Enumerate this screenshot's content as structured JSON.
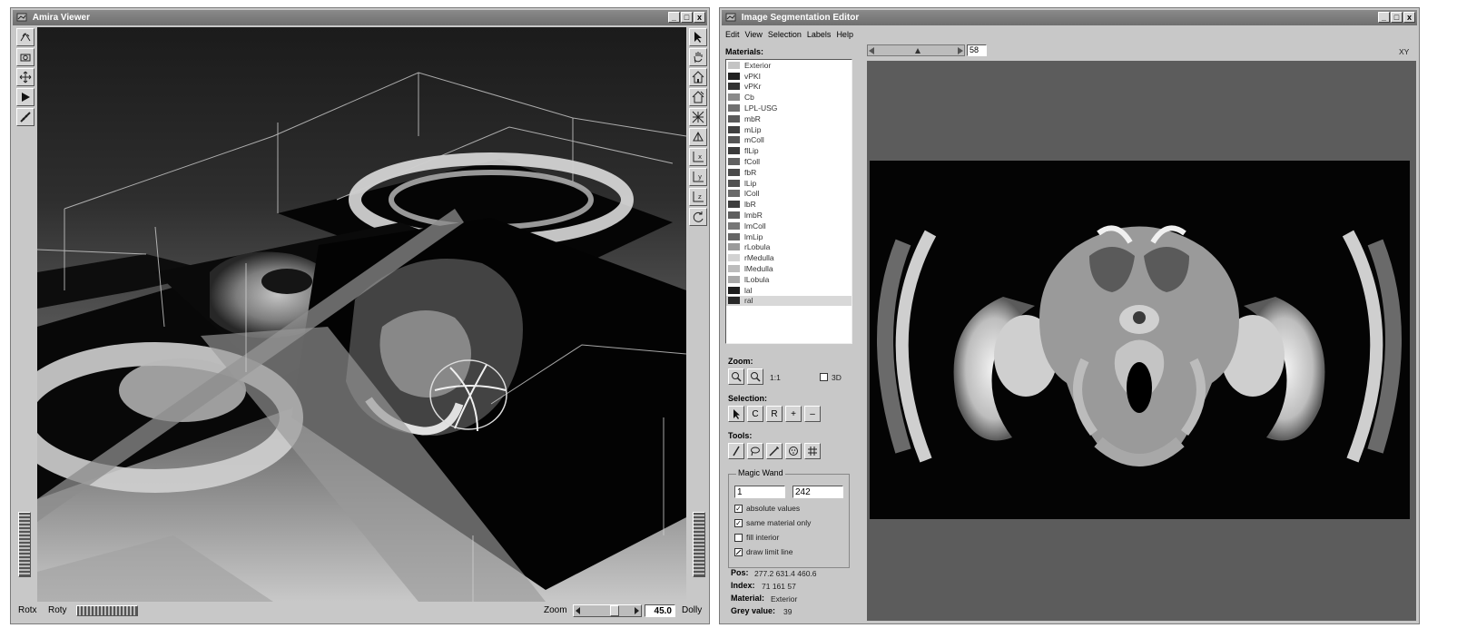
{
  "viewer": {
    "title": "Amira Viewer",
    "window_buttons": [
      "_",
      "□",
      "x"
    ],
    "left_toolbar": [
      {
        "icon": "interact-icon"
      },
      {
        "icon": "camera-icon"
      },
      {
        "icon": "move-icon"
      },
      {
        "icon": "play-icon"
      },
      {
        "icon": "measure-icon"
      }
    ],
    "right_toolbar": [
      {
        "icon": "pointer-icon"
      },
      {
        "icon": "hand-icon"
      },
      {
        "icon": "home-icon"
      },
      {
        "icon": "set-home-icon"
      },
      {
        "icon": "view-all-icon"
      },
      {
        "icon": "perspective-icon"
      },
      {
        "icon": "axis-x-icon"
      },
      {
        "icon": "axis-y-icon"
      },
      {
        "icon": "axis-z-icon"
      },
      {
        "icon": "rotate-icon"
      }
    ],
    "bottom": {
      "rotx": "Rotx",
      "roty": "Roty",
      "zoom": "Zoom",
      "zoom_value": "45.0",
      "dolly": "Dolly"
    }
  },
  "editor": {
    "title": "Image Segmentation Editor",
    "window_buttons": [
      "_",
      "□",
      "x"
    ],
    "menu": [
      "Edit",
      "View",
      "Selection",
      "Labels",
      "Help"
    ],
    "materials_label": "Materials:",
    "materials": [
      {
        "name": "Exterior",
        "color": "#c4c4c4"
      },
      {
        "name": "vPKI",
        "color": "#222222"
      },
      {
        "name": "vPKr",
        "color": "#333333"
      },
      {
        "name": "Cb",
        "color": "#8a8a8a"
      },
      {
        "name": "LPL-USG",
        "color": "#707070"
      },
      {
        "name": "mbR",
        "color": "#5a5a5a"
      },
      {
        "name": "mLip",
        "color": "#404040"
      },
      {
        "name": "mColl",
        "color": "#555555"
      },
      {
        "name": "flLip",
        "color": "#3a3a3a"
      },
      {
        "name": "fColl",
        "color": "#606060"
      },
      {
        "name": "fbR",
        "color": "#4a4a4a"
      },
      {
        "name": "lLip",
        "color": "#525252"
      },
      {
        "name": "lColl",
        "color": "#6a6a6a"
      },
      {
        "name": "lbR",
        "color": "#3e3e3e"
      },
      {
        "name": "lmbR",
        "color": "#5e5e5e"
      },
      {
        "name": "lmColl",
        "color": "#777777"
      },
      {
        "name": "lmLip",
        "color": "#666666"
      },
      {
        "name": "rLobula",
        "color": "#9a9a9a"
      },
      {
        "name": "rMedulla",
        "color": "#d2d2d2"
      },
      {
        "name": "lMedulla",
        "color": "#bcbcbc"
      },
      {
        "name": "lLobula",
        "color": "#a8a8a8"
      },
      {
        "name": "lal",
        "color": "#1e1e1e"
      },
      {
        "name": "ral",
        "color": "#282828"
      }
    ],
    "selected_material_index": 22,
    "slice": {
      "value": "58",
      "orientation": "XY"
    },
    "zoom": {
      "label": "Zoom:",
      "ratio": "1:1",
      "three_d": "3D"
    },
    "selection": {
      "label": "Selection:",
      "buttons": [
        "C",
        "R",
        "+",
        "–"
      ]
    },
    "tools": {
      "label": "Tools:"
    },
    "magic_wand": {
      "label": "Magic Wand",
      "low": "1",
      "high": "242",
      "options": [
        {
          "label": "absolute values",
          "checked": true
        },
        {
          "label": "same material only",
          "checked": true
        },
        {
          "label": "fill interior",
          "checked": false
        },
        {
          "label": "draw limit line",
          "checked": false
        }
      ]
    },
    "info": {
      "pos_label": "Pos:",
      "pos": "277.2 631.4 460.6",
      "index_label": "Index:",
      "index": "71 161 57",
      "material_label": "Material:",
      "material": "Exterior",
      "grey_label": "Grey value:",
      "grey": "39"
    }
  }
}
